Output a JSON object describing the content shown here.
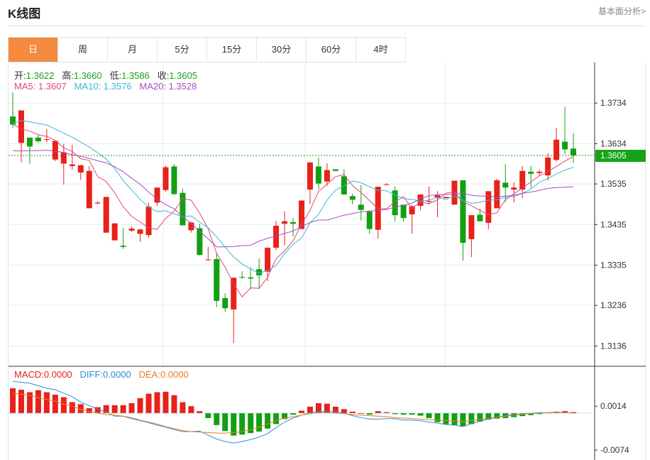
{
  "header": {
    "title": "K线图",
    "link": "基本面分析>"
  },
  "tabs": [
    {
      "label": "日",
      "active": true
    },
    {
      "label": "周",
      "active": false
    },
    {
      "label": "月",
      "active": false
    },
    {
      "label": "5分",
      "active": false
    },
    {
      "label": "15分",
      "active": false
    },
    {
      "label": "30分",
      "active": false
    },
    {
      "label": "60分",
      "active": false
    },
    {
      "label": "4时",
      "active": false
    }
  ],
  "ohlc_info": {
    "open_label": "开:",
    "open": "1.3622",
    "high_label": "高:",
    "high": "1.3660",
    "low_label": "低:",
    "low": "1.3586",
    "close_label": "收:",
    "close": "1.3605"
  },
  "ma_info": {
    "ma5_label": "MA5:",
    "ma5": "1.3607",
    "ma10_label": "MA10:",
    "ma10": "1.3576",
    "ma20_label": "MA20:",
    "ma20": "1.3528"
  },
  "macd_info": {
    "macd_label": "MACD:",
    "macd": "0.0000",
    "diff_label": "DIFF:",
    "diff": "0.0000",
    "dea_label": "DEA:",
    "dea": "0.0000"
  },
  "colors": {
    "up": "#e8211a",
    "down": "#12a012",
    "ma5": "#e0487c",
    "ma10": "#3bb8d8",
    "ma20": "#a94bc4",
    "diff": "#2b8fd8",
    "dea": "#ee7a22",
    "price_tag": "#17a317"
  },
  "chart_data": {
    "type": "candlestick",
    "price_ylim": [
      1.3086,
      1.3834
    ],
    "price_ticks": [
      "1.3734",
      "1.3634",
      "1.3535",
      "1.3435",
      "1.3335",
      "1.3236",
      "1.3136"
    ],
    "current_price": "1.3605",
    "macd_ylim": [
      -0.0094,
      0.0094
    ],
    "macd_ticks": [
      "0.0014",
      "-0.0074"
    ],
    "candles": [
      [
        1.3701,
        1.376,
        1.3673,
        1.3681
      ],
      [
        1.3636,
        1.3716,
        1.3588,
        1.3716
      ],
      [
        1.3649,
        1.3627,
        1.3585,
        1.3627
      ],
      [
        1.3649,
        1.3655,
        1.3636,
        1.364
      ],
      [
        1.3645,
        1.367,
        1.3638,
        1.3645
      ],
      [
        1.3595,
        1.3631,
        1.3591,
        1.3641
      ],
      [
        1.3585,
        1.3634,
        1.3533,
        1.3613
      ],
      [
        1.3579,
        1.3631,
        1.357,
        1.3583
      ],
      [
        1.3563,
        1.3582,
        1.3545,
        1.3581
      ],
      [
        1.3475,
        1.3579,
        1.3475,
        1.3567
      ],
      [
        1.3487,
        1.3493,
        1.3485,
        1.3489
      ],
      [
        1.3415,
        1.3503,
        1.3415,
        1.3503
      ],
      [
        1.3396,
        1.3438,
        1.3396,
        1.3438
      ],
      [
        1.3383,
        1.3427,
        1.3375,
        1.338
      ],
      [
        1.342,
        1.343,
        1.3416,
        1.3425
      ],
      [
        1.3412,
        1.3424,
        1.3392,
        1.3423
      ],
      [
        1.3409,
        1.3489,
        1.3403,
        1.3479
      ],
      [
        1.3489,
        1.3526,
        1.3481,
        1.3526
      ],
      [
        1.352,
        1.358,
        1.3516,
        1.3576
      ],
      [
        1.3578,
        1.3584,
        1.3508,
        1.351
      ],
      [
        1.3513,
        1.3523,
        1.3433,
        1.3433
      ],
      [
        1.3421,
        1.3442,
        1.3415,
        1.344
      ],
      [
        1.3426,
        1.3437,
        1.3359,
        1.336
      ],
      [
        1.3349,
        1.338,
        1.3346,
        1.3349
      ],
      [
        1.335,
        1.3364,
        1.3232,
        1.3247
      ],
      [
        1.3254,
        1.3266,
        1.322,
        1.3229
      ],
      [
        1.3226,
        1.3304,
        1.3143,
        1.3304
      ],
      [
        1.3306,
        1.332,
        1.3301,
        1.3305
      ],
      [
        1.3305,
        1.333,
        1.3276,
        1.3302
      ],
      [
        1.3325,
        1.3352,
        1.3276,
        1.331
      ],
      [
        1.3319,
        1.3378,
        1.3296,
        1.3378
      ],
      [
        1.3378,
        1.3444,
        1.3372,
        1.3432
      ],
      [
        1.3437,
        1.3468,
        1.3384,
        1.3443
      ],
      [
        1.3441,
        1.3451,
        1.3406,
        1.3437
      ],
      [
        1.3424,
        1.3495,
        1.3424,
        1.3494
      ],
      [
        1.3521,
        1.3588,
        1.3485,
        1.3588
      ],
      [
        1.3578,
        1.36,
        1.3521,
        1.3536
      ],
      [
        1.3541,
        1.3586,
        1.353,
        1.3569
      ],
      [
        1.3571,
        1.3567,
        1.3566,
        1.3567
      ],
      [
        1.3554,
        1.3571,
        1.3509,
        1.3509
      ],
      [
        1.3505,
        1.3511,
        1.3485,
        1.3496
      ],
      [
        1.3484,
        1.3532,
        1.3445,
        1.3471
      ],
      [
        1.3467,
        1.347,
        1.3412,
        1.3424
      ],
      [
        1.3422,
        1.3528,
        1.34,
        1.3528
      ],
      [
        1.3533,
        1.3537,
        1.3532,
        1.3534
      ],
      [
        1.3519,
        1.3529,
        1.3443,
        1.3458
      ],
      [
        1.3484,
        1.348,
        1.3442,
        1.3451
      ],
      [
        1.346,
        1.3483,
        1.3413,
        1.348
      ],
      [
        1.3481,
        1.3509,
        1.347,
        1.3509
      ],
      [
        1.3491,
        1.3529,
        1.3484,
        1.3493
      ],
      [
        1.3502,
        1.3517,
        1.3453,
        1.3507
      ],
      [
        1.35,
        1.3503,
        1.3502,
        1.3503
      ],
      [
        1.3484,
        1.3542,
        1.3484,
        1.3543
      ],
      [
        1.3544,
        1.3535,
        1.3346,
        1.339
      ],
      [
        1.3399,
        1.3451,
        1.3355,
        1.3458
      ],
      [
        1.3459,
        1.3474,
        1.3443,
        1.3443
      ],
      [
        1.3439,
        1.3517,
        1.3424,
        1.3517
      ],
      [
        1.3475,
        1.3548,
        1.3475,
        1.3544
      ],
      [
        1.3538,
        1.3584,
        1.349,
        1.3526
      ],
      [
        1.3521,
        1.3539,
        1.3489,
        1.3526
      ],
      [
        1.3521,
        1.3579,
        1.35,
        1.3567
      ],
      [
        1.3565,
        1.3579,
        1.3525,
        1.356
      ],
      [
        1.3562,
        1.357,
        1.3555,
        1.3565
      ],
      [
        1.3556,
        1.3611,
        1.3544,
        1.36
      ],
      [
        1.3594,
        1.3672,
        1.359,
        1.3644
      ],
      [
        1.3639,
        1.3725,
        1.3608,
        1.362
      ],
      [
        1.3622,
        1.366,
        1.3586,
        1.3605
      ]
    ],
    "ma5": [
      1.3682,
      1.367,
      1.3665,
      1.3656,
      1.3652,
      1.3642,
      1.3624,
      1.3615,
      1.3597,
      1.3593,
      1.3553,
      1.3541,
      1.3513,
      1.3479,
      1.3455,
      1.3441,
      1.3427,
      1.3423,
      1.345,
      1.3468,
      1.3499,
      1.3495,
      1.3463,
      1.3425,
      1.3364,
      1.333,
      1.3289,
      1.3257,
      1.3279,
      1.3278,
      1.3305,
      1.3351,
      1.337,
      1.3395,
      1.3436,
      1.347,
      1.3517,
      1.3534,
      1.3553,
      1.3558,
      1.3531,
      1.3514,
      1.3494,
      1.3474,
      1.3474,
      1.3491,
      1.3504,
      1.3474,
      1.3491,
      1.3486,
      1.3496,
      1.3512,
      1.3516,
      1.3491,
      1.3481,
      1.347,
      1.3459,
      1.3464,
      1.3496,
      1.3511,
      1.3525,
      1.354,
      1.3555,
      1.3565,
      1.3578,
      1.3591,
      1.3603
    ],
    "ma10": [
      1.3683,
      1.3691,
      1.3688,
      1.3684,
      1.368,
      1.367,
      1.366,
      1.365,
      1.3638,
      1.3626,
      1.3612,
      1.3596,
      1.3573,
      1.3543,
      1.352,
      1.3497,
      1.3478,
      1.3467,
      1.3469,
      1.3461,
      1.3455,
      1.3456,
      1.3441,
      1.3427,
      1.3405,
      1.338,
      1.3355,
      1.3338,
      1.3326,
      1.3315,
      1.3322,
      1.3334,
      1.3363,
      1.3386,
      1.3402,
      1.3439,
      1.346,
      1.3495,
      1.352,
      1.353,
      1.3542,
      1.3538,
      1.3528,
      1.3519,
      1.3518,
      1.3508,
      1.3499,
      1.3497,
      1.3493,
      1.3495,
      1.3502,
      1.3497,
      1.3505,
      1.3495,
      1.3487,
      1.349,
      1.3495,
      1.3496,
      1.3502,
      1.3504,
      1.3512,
      1.3522,
      1.3539,
      1.3548,
      1.356,
      1.3569,
      1.3576
    ],
    "ma20": [
      1.3617,
      1.3616,
      1.3617,
      1.3617,
      1.3618,
      1.3616,
      1.3612,
      1.3607,
      1.3603,
      1.3598,
      1.3592,
      1.3587,
      1.3577,
      1.3565,
      1.3549,
      1.3534,
      1.3515,
      1.3498,
      1.3484,
      1.3474,
      1.3454,
      1.3438,
      1.3418,
      1.34,
      1.338,
      1.338,
      1.3381,
      1.3383,
      1.3384,
      1.3394,
      1.3401,
      1.3407,
      1.3413,
      1.3419,
      1.343,
      1.344,
      1.3446,
      1.3446,
      1.3452,
      1.3458,
      1.3462,
      1.3466,
      1.3468,
      1.347,
      1.3472,
      1.3478,
      1.3482,
      1.3488,
      1.3498,
      1.3506,
      1.3509,
      1.3509,
      1.351,
      1.3512,
      1.3507,
      1.3505,
      1.3505,
      1.3503,
      1.3505,
      1.3507,
      1.3512,
      1.3515,
      1.3519,
      1.3524,
      1.3526,
      1.3527,
      1.3528
    ],
    "macd_hist": [
      0.005,
      0.0047,
      0.0042,
      0.0046,
      0.0042,
      0.0037,
      0.0032,
      0.0022,
      0.0018,
      0.001,
      0.0012,
      0.0016,
      0.0016,
      0.0016,
      0.002,
      0.003,
      0.0039,
      0.0042,
      0.0043,
      0.0036,
      0.0022,
      0.0014,
      0.0004,
      -0.001,
      -0.0024,
      -0.0036,
      -0.0045,
      -0.0043,
      -0.004,
      -0.0037,
      -0.0031,
      -0.0022,
      -0.0012,
      -0.0003,
      0.0005,
      0.0013,
      0.002,
      0.0019,
      0.0013,
      0.0008,
      0.0003,
      0.0,
      -0.0003,
      0.0004,
      0.0002,
      -0.0002,
      -0.0003,
      -0.0003,
      -0.0005,
      -0.001,
      -0.0018,
      -0.0022,
      -0.0024,
      -0.0026,
      -0.0022,
      -0.0017,
      -0.0013,
      -0.0011,
      -0.001,
      -0.0008,
      -0.0006,
      -0.0004,
      -0.0002,
      0.0001,
      0.0003,
      0.0004,
      0.0002
    ],
    "diff": [
      0.0064,
      0.0062,
      0.006,
      0.0055,
      0.005,
      0.0047,
      0.004,
      0.0033,
      0.0022,
      0.0015,
      0.0008,
      0.0002,
      -0.0006,
      -0.0006,
      -0.0011,
      -0.0015,
      -0.0019,
      -0.0024,
      -0.0028,
      -0.0033,
      -0.0037,
      -0.0037,
      -0.0036,
      -0.0044,
      -0.0052,
      -0.0057,
      -0.006,
      -0.0057,
      -0.0053,
      -0.0048,
      -0.0041,
      -0.0029,
      -0.0018,
      -0.001,
      -0.0004,
      0.0001,
      0.0003,
      0.0004,
      0.0003,
      0.0,
      -0.0005,
      -0.0009,
      -0.0012,
      -0.0012,
      -0.0011,
      -0.0011,
      -0.0014,
      -0.0014,
      -0.0015,
      -0.0018,
      -0.002,
      -0.0023,
      -0.0024,
      -0.0027,
      -0.0021,
      -0.0016,
      -0.0012,
      -0.0008,
      -0.0005,
      -0.0003,
      -0.0001,
      0.0,
      0.0001,
      0.0001,
      0.0002,
      0.0001,
      0.0
    ],
    "dea": [
      0.004,
      0.0038,
      0.0036,
      0.0031,
      0.0027,
      0.0024,
      0.0018,
      0.0014,
      0.0007,
      0.0003,
      0.0,
      -0.0003,
      -0.0004,
      -0.0006,
      -0.0009,
      -0.0014,
      -0.0018,
      -0.0022,
      -0.0027,
      -0.0031,
      -0.0035,
      -0.0037,
      -0.0038,
      -0.0039,
      -0.004,
      -0.004,
      -0.0039,
      -0.0037,
      -0.0033,
      -0.0028,
      -0.0022,
      -0.0015,
      -0.001,
      -0.0007,
      -0.0004,
      -0.0001,
      0.0001,
      0.0001,
      0.0,
      -0.0001,
      -0.0003,
      -0.0004,
      -0.0005,
      -0.0006,
      -0.0007,
      -0.0009,
      -0.001,
      -0.0011,
      -0.0012,
      -0.0013,
      -0.0014,
      -0.0015,
      -0.0016,
      -0.0017,
      -0.0015,
      -0.0013,
      -0.001,
      -0.0008,
      -0.0006,
      -0.0004,
      -0.0002,
      -0.0001,
      0.0,
      0.0001,
      0.0001,
      0.0001,
      0.0
    ]
  }
}
